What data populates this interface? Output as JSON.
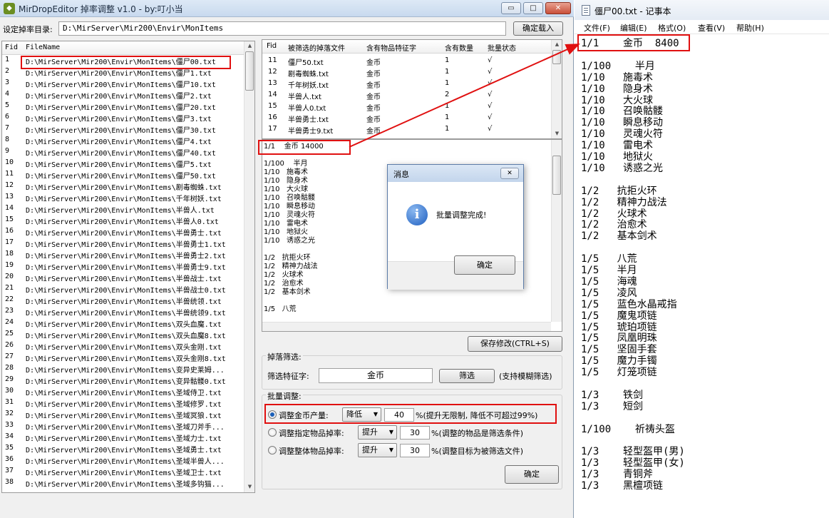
{
  "app": {
    "title": "MirDropEditor 掉率调整 v1.0 - by:叮小当",
    "min_glyph": "▭",
    "max_glyph": "□",
    "close_glyph": "✕",
    "dir_label": "设定掉率目录:",
    "dir_value": "D:\\MirServer\\Mir200\\Envir\\MonItems",
    "load_button": "确定载入"
  },
  "file_list": {
    "col_fid": "Fid",
    "col_filename": "FileName",
    "rows": [
      {
        "fid": "1",
        "name": "D:\\MirServer\\Mir200\\Envir\\MonItems\\僵尸00.txt"
      },
      {
        "fid": "2",
        "name": "D:\\MirServer\\Mir200\\Envir\\MonItems\\僵尸1.txt"
      },
      {
        "fid": "3",
        "name": "D:\\MirServer\\Mir200\\Envir\\MonItems\\僵尸10.txt"
      },
      {
        "fid": "4",
        "name": "D:\\MirServer\\Mir200\\Envir\\MonItems\\僵尸2.txt"
      },
      {
        "fid": "5",
        "name": "D:\\MirServer\\Mir200\\Envir\\MonItems\\僵尸20.txt"
      },
      {
        "fid": "6",
        "name": "D:\\MirServer\\Mir200\\Envir\\MonItems\\僵尸3.txt"
      },
      {
        "fid": "7",
        "name": "D:\\MirServer\\Mir200\\Envir\\MonItems\\僵尸30.txt"
      },
      {
        "fid": "8",
        "name": "D:\\MirServer\\Mir200\\Envir\\MonItems\\僵尸4.txt"
      },
      {
        "fid": "9",
        "name": "D:\\MirServer\\Mir200\\Envir\\MonItems\\僵尸40.txt"
      },
      {
        "fid": "10",
        "name": "D:\\MirServer\\Mir200\\Envir\\MonItems\\僵尸5.txt"
      },
      {
        "fid": "11",
        "name": "D:\\MirServer\\Mir200\\Envir\\MonItems\\僵尸50.txt"
      },
      {
        "fid": "12",
        "name": "D:\\MirServer\\Mir200\\Envir\\MonItems\\剧毒蜘蛛.txt"
      },
      {
        "fid": "13",
        "name": "D:\\MirServer\\Mir200\\Envir\\MonItems\\千年树妖.txt"
      },
      {
        "fid": "14",
        "name": "D:\\MirServer\\Mir200\\Envir\\MonItems\\半兽人.txt"
      },
      {
        "fid": "15",
        "name": "D:\\MirServer\\Mir200\\Envir\\MonItems\\半兽人0.txt"
      },
      {
        "fid": "16",
        "name": "D:\\MirServer\\Mir200\\Envir\\MonItems\\半兽勇士.txt"
      },
      {
        "fid": "17",
        "name": "D:\\MirServer\\Mir200\\Envir\\MonItems\\半兽勇士1.txt"
      },
      {
        "fid": "18",
        "name": "D:\\MirServer\\Mir200\\Envir\\MonItems\\半兽勇士2.txt"
      },
      {
        "fid": "19",
        "name": "D:\\MirServer\\Mir200\\Envir\\MonItems\\半兽勇士9.txt"
      },
      {
        "fid": "20",
        "name": "D:\\MirServer\\Mir200\\Envir\\MonItems\\半兽战士.txt"
      },
      {
        "fid": "21",
        "name": "D:\\MirServer\\Mir200\\Envir\\MonItems\\半兽战士0.txt"
      },
      {
        "fid": "22",
        "name": "D:\\MirServer\\Mir200\\Envir\\MonItems\\半兽统领.txt"
      },
      {
        "fid": "23",
        "name": "D:\\MirServer\\Mir200\\Envir\\MonItems\\半兽统领9.txt"
      },
      {
        "fid": "24",
        "name": "D:\\MirServer\\Mir200\\Envir\\MonItems\\双头血魔.txt"
      },
      {
        "fid": "25",
        "name": "D:\\MirServer\\Mir200\\Envir\\MonItems\\双头血魔8.txt"
      },
      {
        "fid": "26",
        "name": "D:\\MirServer\\Mir200\\Envir\\MonItems\\双头金刚.txt"
      },
      {
        "fid": "27",
        "name": "D:\\MirServer\\Mir200\\Envir\\MonItems\\双头金刚8.txt"
      },
      {
        "fid": "28",
        "name": "D:\\MirServer\\Mir200\\Envir\\MonItems\\变异史莱姆..."
      },
      {
        "fid": "29",
        "name": "D:\\MirServer\\Mir200\\Envir\\MonItems\\变异骷髅0.txt"
      },
      {
        "fid": "30",
        "name": "D:\\MirServer\\Mir200\\Envir\\MonItems\\圣域侍卫.txt"
      },
      {
        "fid": "31",
        "name": "D:\\MirServer\\Mir200\\Envir\\MonItems\\圣域修罗.txt"
      },
      {
        "fid": "32",
        "name": "D:\\MirServer\\Mir200\\Envir\\MonItems\\圣域冥狼.txt"
      },
      {
        "fid": "33",
        "name": "D:\\MirServer\\Mir200\\Envir\\MonItems\\圣域刀斧手..."
      },
      {
        "fid": "34",
        "name": "D:\\MirServer\\Mir200\\Envir\\MonItems\\圣域力士.txt"
      },
      {
        "fid": "35",
        "name": "D:\\MirServer\\Mir200\\Envir\\MonItems\\圣域勇士.txt"
      },
      {
        "fid": "36",
        "name": "D:\\MirServer\\Mir200\\Envir\\MonItems\\圣域半兽人..."
      },
      {
        "fid": "37",
        "name": "D:\\MirServer\\Mir200\\Envir\\MonItems\\圣域卫士.txt"
      },
      {
        "fid": "38",
        "name": "D:\\MirServer\\Mir200\\Envir\\MonItems\\圣域多钩猫..."
      }
    ]
  },
  "item_table": {
    "headers": [
      "Fid",
      "被筛选的掉落文件",
      "含有物品特征字",
      "含有数量",
      "批量状态"
    ],
    "rows": [
      {
        "fid": "11",
        "file": "僵尸50.txt",
        "feature": "金币",
        "count": "1",
        "status": "√"
      },
      {
        "fid": "12",
        "file": "剧毒蜘蛛.txt",
        "feature": "金币",
        "count": "1",
        "status": "√"
      },
      {
        "fid": "13",
        "file": "千年树妖.txt",
        "feature": "金币",
        "count": "1",
        "status": "√"
      },
      {
        "fid": "14",
        "file": "半兽人.txt",
        "feature": "金币",
        "count": "2",
        "status": "√"
      },
      {
        "fid": "15",
        "file": "半兽人0.txt",
        "feature": "金币",
        "count": "1",
        "status": "√"
      },
      {
        "fid": "16",
        "file": "半兽勇士.txt",
        "feature": "金币",
        "count": "1",
        "status": "√"
      },
      {
        "fid": "17",
        "file": "半兽勇士9.txt",
        "feature": "金币",
        "count": "1",
        "status": "√"
      }
    ]
  },
  "preview": {
    "lines": [
      "1/1    金币 14000",
      "",
      "1/100    半月",
      "1/10   施毒术",
      "1/10   隐身术",
      "1/10   大火球",
      "1/10   召唤骷髅",
      "1/10   瞬息移动",
      "1/10   灵魂火符",
      "1/10   雷电术",
      "1/10   地狱火",
      "1/10   诱惑之光",
      "",
      "1/2   抗拒火环",
      "1/2   精神力战法",
      "1/2   火球术",
      "1/2   治愈术",
      "1/2   基本剑术",
      "",
      "1/5   八荒"
    ]
  },
  "save_button": "保存修改(CTRL+S)",
  "filter": {
    "group_title": "掉落筛选:",
    "label": "筛选特征字:",
    "value": "金币",
    "button": "筛选",
    "note": "(支持模糊筛选)"
  },
  "batch": {
    "group_title": "批量调整:",
    "opt1_label": "调整金币产量:",
    "opt1_mode": "降低",
    "opt1_value": "40",
    "opt1_note": "%(提升无限制, 降低不可超过99%)",
    "opt2_label": "调整指定物品掉率:",
    "opt2_mode": "提升",
    "opt2_value": "30",
    "opt2_note": "%(调整的物品是筛选条件)",
    "opt3_label": "调整整体物品掉率:",
    "opt3_mode": "提升",
    "opt3_value": "30",
    "opt3_note": "%(调整目标为被筛选文件)",
    "confirm_button": "确定"
  },
  "dialog": {
    "title": "消息",
    "close_glyph": "✕",
    "icon_glyph": "i",
    "message": "批量调整完成!",
    "ok_button": "确定"
  },
  "notepad": {
    "title": "僵尸00.txt - 记事本",
    "menus": [
      "文件(F)",
      "编辑(E)",
      "格式(O)",
      "查看(V)",
      "帮助(H)"
    ],
    "lines": [
      "1/1    金币  8400",
      "",
      "1/100    半月",
      "1/10   施毒术",
      "1/10   隐身术",
      "1/10   大火球",
      "1/10   召唤骷髅",
      "1/10   瞬息移动",
      "1/10   灵魂火符",
      "1/10   雷电术",
      "1/10   地狱火",
      "1/10   诱惑之光",
      "",
      "1/2   抗拒火环",
      "1/2   精神力战法",
      "1/2   火球术",
      "1/2   治愈术",
      "1/2   基本剑术",
      "",
      "1/5   八荒",
      "1/5   半月",
      "1/5   海魂",
      "1/5   凌风",
      "1/5   蓝色水晶戒指",
      "1/5   魔鬼项链",
      "1/5   琥珀项链",
      "1/5   凤凰明珠",
      "1/5   坚固手套",
      "1/5   魔力手镯",
      "1/5   灯笼项链",
      "",
      "1/3    铁剑",
      "1/3    短剑",
      "",
      "1/100    祈祷头盔",
      "",
      "1/3    轻型盔甲(男)",
      "1/3    轻型盔甲(女)",
      "1/3    青铜斧",
      "1/3    黑檀项链"
    ]
  },
  "colors": {
    "highlight_box": "#e01010",
    "arrow": "#e01010"
  }
}
